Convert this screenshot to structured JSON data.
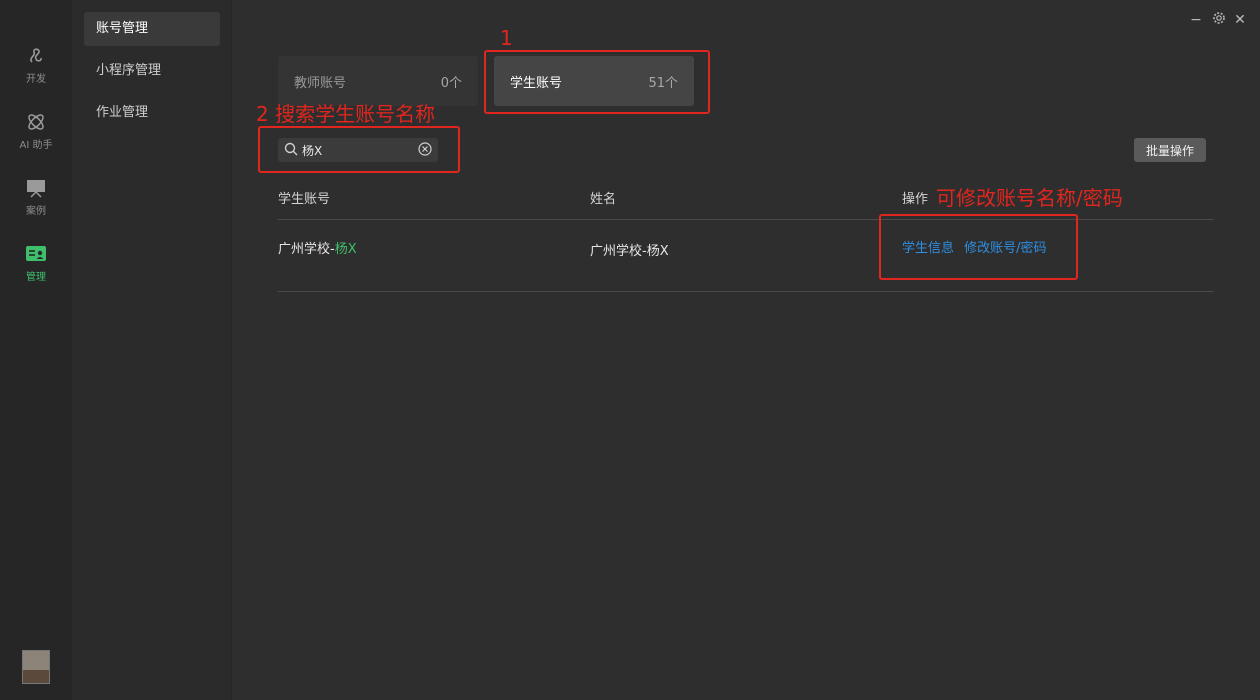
{
  "rail": {
    "items": [
      {
        "label": "开发",
        "icon": "dev-icon"
      },
      {
        "label": "AI 助手",
        "icon": "ai-assistant-icon"
      },
      {
        "label": "案例",
        "icon": "case-icon"
      },
      {
        "label": "管理",
        "icon": "manage-icon"
      }
    ],
    "active_color": "#3fbf6b"
  },
  "submenu": {
    "items": [
      {
        "label": "账号管理"
      },
      {
        "label": "小程序管理"
      },
      {
        "label": "作业管理"
      }
    ]
  },
  "window": {
    "minimize": "−",
    "settings_icon": "gear-icon",
    "close": "✕"
  },
  "tabs": [
    {
      "label": "教师账号",
      "count": "0个"
    },
    {
      "label": "学生账号",
      "count": "51个"
    }
  ],
  "search": {
    "value": "杨X",
    "icon": "search-icon",
    "clear_icon": "clear-icon"
  },
  "toolbar": {
    "batch_label": "批量操作"
  },
  "table": {
    "headers": [
      "学生账号",
      "姓名",
      "操作"
    ],
    "rows": [
      {
        "account_prefix": "广州学校-",
        "account_highlight": "杨X",
        "name": "广州学校-杨X",
        "actions": [
          "学生信息",
          "修改账号/密码"
        ]
      }
    ]
  },
  "annotations": {
    "a1": "1",
    "a2": "2 搜索学生账号名称",
    "a3": "可修改账号名称/密码",
    "color": "#e0261e"
  }
}
